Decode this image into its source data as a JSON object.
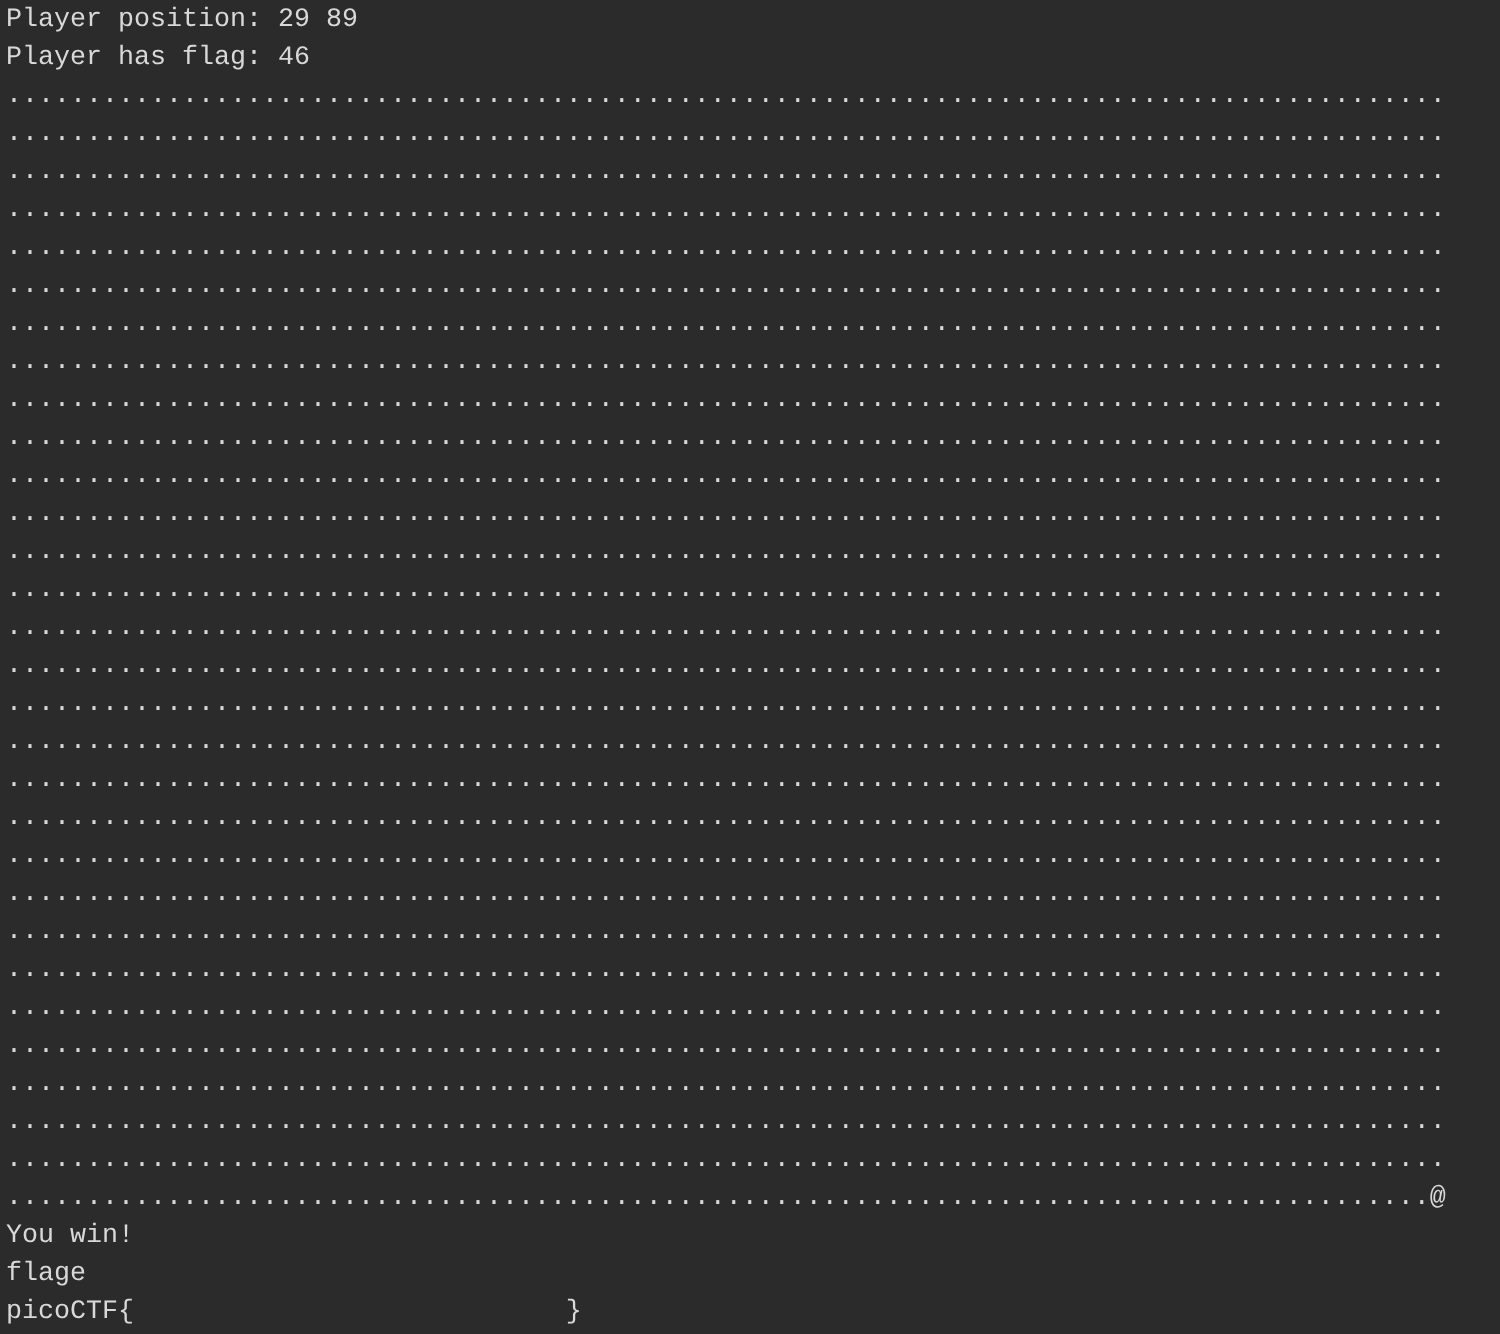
{
  "status_lines": [
    "Player position: 29 89",
    "Player has flag: 46"
  ],
  "map_rows": [
    "..........................................................................................",
    "..........................................................................................",
    "..........................................................................................",
    "..........................................................................................",
    "..........................................................................................",
    "..........................................................................................",
    "..........................................................................................",
    "..........................................................................................",
    "..........................................................................................",
    "..........................................................................................",
    "..........................................................................................",
    "..........................................................................................",
    "..........................................................................................",
    "..........................................................................................",
    "..........................................................................................",
    "..........................................................................................",
    "..........................................................................................",
    "..........................................................................................",
    "..........................................................................................",
    "..........................................................................................",
    "..........................................................................................",
    "..........................................................................................",
    "..........................................................................................",
    "..........................................................................................",
    "..........................................................................................",
    "..........................................................................................",
    "..........................................................................................",
    "..........................................................................................",
    "..........................................................................................",
    ".........................................................................................@"
  ],
  "result_lines": [
    "You win!",
    "flage",
    "picoCTF{                           }"
  ]
}
